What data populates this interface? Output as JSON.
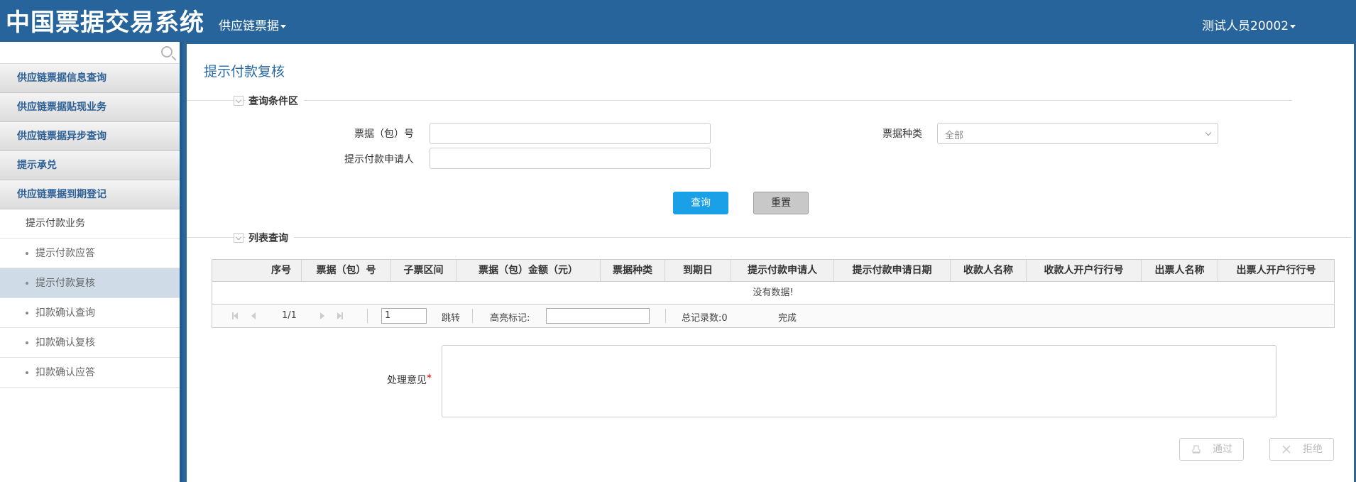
{
  "header": {
    "app_title": "中国票据交易系统",
    "nav_menu": "供应链票据",
    "user": "测试人员20002"
  },
  "sidebar": {
    "groups": [
      {
        "label": "供应链票据信息查询"
      },
      {
        "label": "供应链票据贴现业务"
      },
      {
        "label": "供应链票据异步查询"
      },
      {
        "label": "提示承兑"
      },
      {
        "label": "供应链票据到期登记"
      }
    ],
    "sub_title": "提示付款业务",
    "items": [
      {
        "label": "提示付款应答"
      },
      {
        "label": "提示付款复核"
      },
      {
        "label": "扣款确认查询"
      },
      {
        "label": "扣款确认复核"
      },
      {
        "label": "扣款确认应答"
      }
    ]
  },
  "main": {
    "title": "提示付款复核",
    "query_section": "查询条件区",
    "fields": {
      "bill_no_label": "票据（包）号",
      "bill_no_value": "",
      "applicant_label": "提示付款申请人",
      "applicant_value": "",
      "bill_type_label": "票据种类",
      "bill_type_value": "全部"
    },
    "query_button": "查询",
    "reset_button": "重置",
    "list_section": "列表查询",
    "table": {
      "columns": [
        "序号",
        "票据（包）号",
        "子票区间",
        "票据（包）金额（元）",
        "票据种类",
        "到期日",
        "提示付款申请人",
        "提示付款申请日期",
        "收款人名称",
        "收款人开户行行号",
        "出票人名称",
        "出票人开户行行号"
      ],
      "empty_text": "没有数据!"
    },
    "pager": {
      "page_info": "1/1",
      "page_input": "1",
      "jump": "跳转",
      "highlight_label": "高亮标记:",
      "total": "总记录数:0",
      "status": "完成"
    },
    "opinion_label": "处理意见",
    "opinion_required": "*",
    "approve_button": "通过",
    "reject_button": "拒绝"
  }
}
